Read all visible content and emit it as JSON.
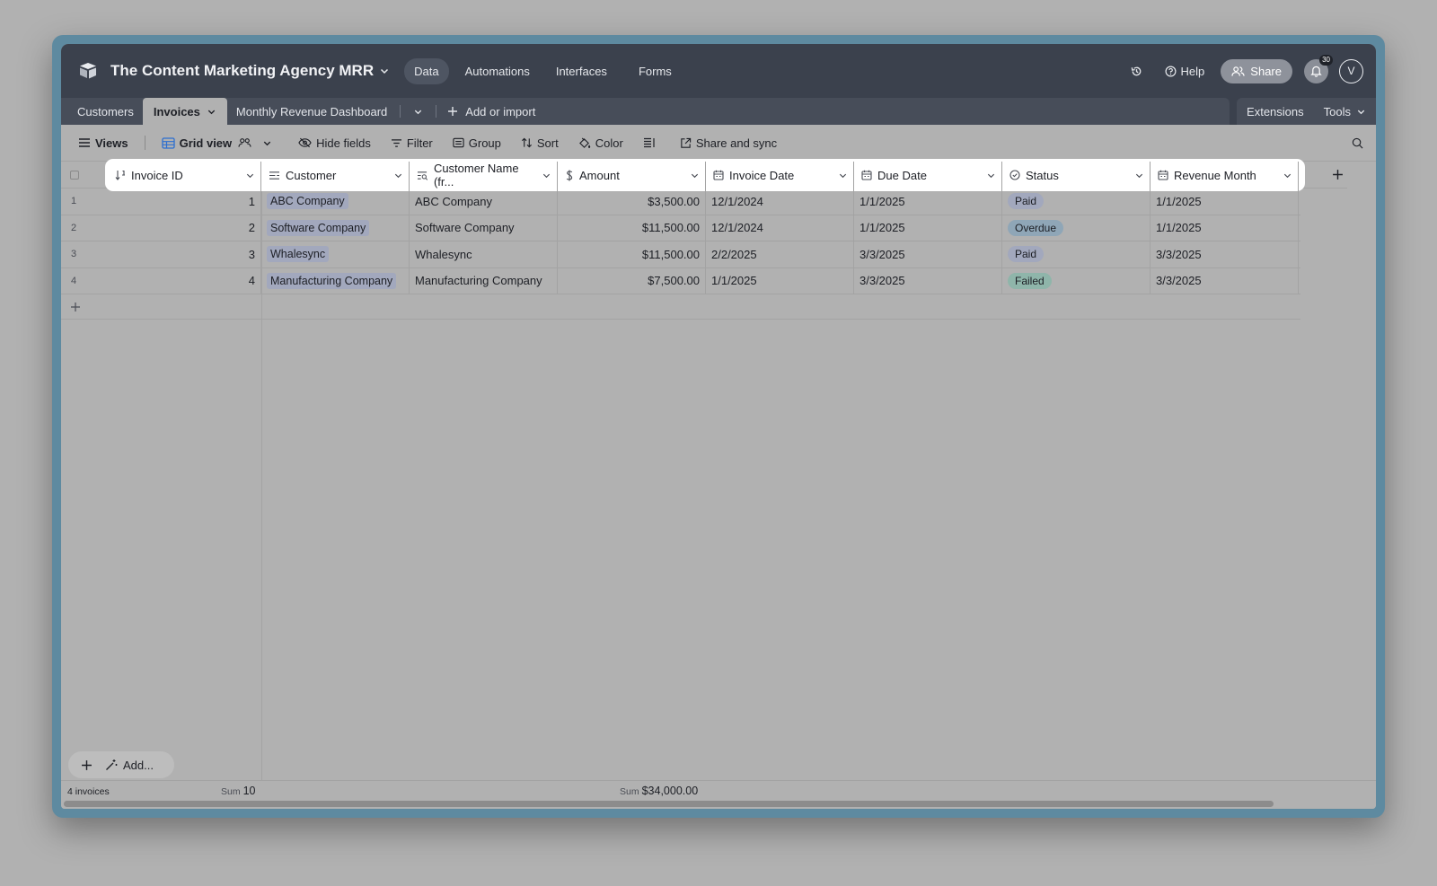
{
  "topbar": {
    "base_title": "The Content Marketing Agency MRR",
    "nav": [
      {
        "label": "Data",
        "active": true
      },
      {
        "label": "Automations"
      },
      {
        "label": "Interfaces"
      },
      {
        "label": "Forms"
      }
    ],
    "help_label": "Help",
    "share_label": "Share",
    "notification_count": "30",
    "avatar_initial": "V"
  },
  "tabs": {
    "items": [
      "Customers",
      "Invoices",
      "Monthly Revenue Dashboard"
    ],
    "active": "Invoices",
    "add_import_label": "Add or import",
    "extensions_label": "Extensions",
    "tools_label": "Tools"
  },
  "toolbar": {
    "views_label": "Views",
    "grid_view_label": "Grid view",
    "hide_fields_label": "Hide fields",
    "filter_label": "Filter",
    "group_label": "Group",
    "sort_label": "Sort",
    "color_label": "Color",
    "share_sync_label": "Share and sync"
  },
  "columns": [
    {
      "label": "Invoice ID",
      "icon": "autonumber-icon"
    },
    {
      "label": "Customer",
      "icon": "link-icon"
    },
    {
      "label": "Customer Name (fr...",
      "icon": "lookup-icon"
    },
    {
      "label": "Amount",
      "icon": "currency-icon"
    },
    {
      "label": "Invoice Date",
      "icon": "calendar-icon"
    },
    {
      "label": "Due Date",
      "icon": "calendar-icon"
    },
    {
      "label": "Status",
      "icon": "status-icon"
    },
    {
      "label": "Revenue Month",
      "icon": "calendar-icon"
    }
  ],
  "rows": [
    {
      "num": "1",
      "invoice_id": "1",
      "customer": "ABC Company",
      "customer_name": "ABC Company",
      "amount": "$3,500.00",
      "invoice_date": "12/1/2024",
      "due_date": "1/1/2025",
      "status": "Paid",
      "revenue_month": "1/1/2025"
    },
    {
      "num": "2",
      "invoice_id": "2",
      "customer": "Software Company",
      "customer_name": "Software Company",
      "amount": "$11,500.00",
      "invoice_date": "12/1/2024",
      "due_date": "1/1/2025",
      "status": "Overdue",
      "revenue_month": "1/1/2025"
    },
    {
      "num": "3",
      "invoice_id": "3",
      "customer": "Whalesync",
      "customer_name": "Whalesync",
      "amount": "$11,500.00",
      "invoice_date": "2/2/2025",
      "due_date": "3/3/2025",
      "status": "Paid",
      "revenue_month": "3/3/2025"
    },
    {
      "num": "4",
      "invoice_id": "4",
      "customer": "Manufacturing Company",
      "customer_name": "Manufacturing Company",
      "amount": "$7,500.00",
      "invoice_date": "1/1/2025",
      "due_date": "3/3/2025",
      "status": "Failed",
      "revenue_month": "3/3/2025"
    }
  ],
  "status_colors": {
    "Paid": "#a2a8bd",
    "Overdue": "#8fa6b7",
    "Failed": "#8fb5aa"
  },
  "bottom": {
    "add_label": "Add..."
  },
  "footer": {
    "record_count": "4 invoices",
    "sum_label": "Sum",
    "sum_invoice_id": "10",
    "sum_amount": "$34,000.00"
  }
}
